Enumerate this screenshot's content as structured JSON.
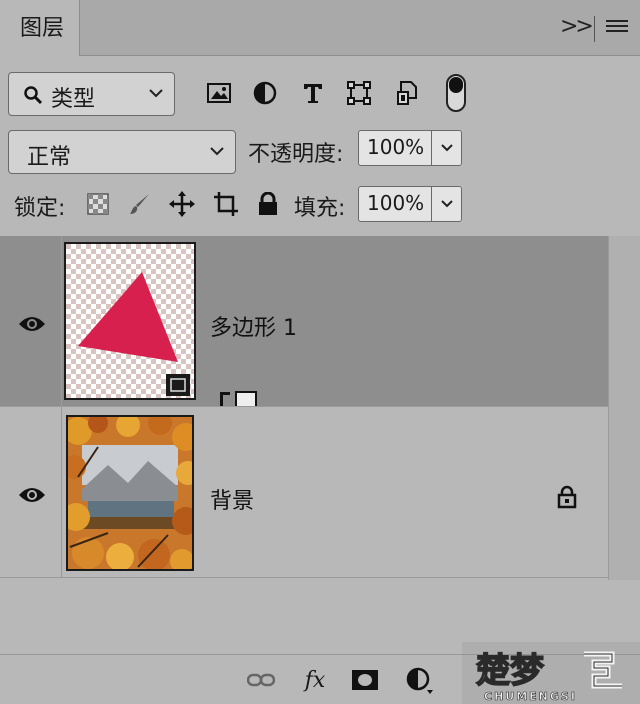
{
  "panel": {
    "tab_label": "图层",
    "collapse_glyph": ">>"
  },
  "filter": {
    "kind_label": "类型",
    "icons": [
      "image-filter-icon",
      "adjustment-filter-icon",
      "type-filter-icon",
      "shape-filter-icon",
      "smart-object-filter-icon"
    ],
    "toggle_on": true
  },
  "blend": {
    "mode": "正常",
    "opacity_label": "不透明度:",
    "opacity": "100%"
  },
  "lock": {
    "label": "锁定:",
    "fill_label": "填充:",
    "fill": "100%"
  },
  "layers": [
    {
      "name": "多边形 1",
      "visible": true,
      "selected": true,
      "kind": "shape",
      "locked": false
    },
    {
      "name": "背景",
      "visible": true,
      "selected": false,
      "kind": "pixel",
      "locked": true
    }
  ],
  "bottom_toolbar": {
    "icons": [
      "link-layers-icon",
      "layer-style-icon",
      "layer-mask-icon",
      "adjustment-layer-icon"
    ],
    "fx_label": "fx"
  },
  "watermark": {
    "title": "楚梦",
    "subtitle": "CHUMENGSI"
  },
  "colors": {
    "panel_bg": "#b8b8b8",
    "selected_row": "#8e8e8e",
    "shape_fill": "#d8204e"
  }
}
